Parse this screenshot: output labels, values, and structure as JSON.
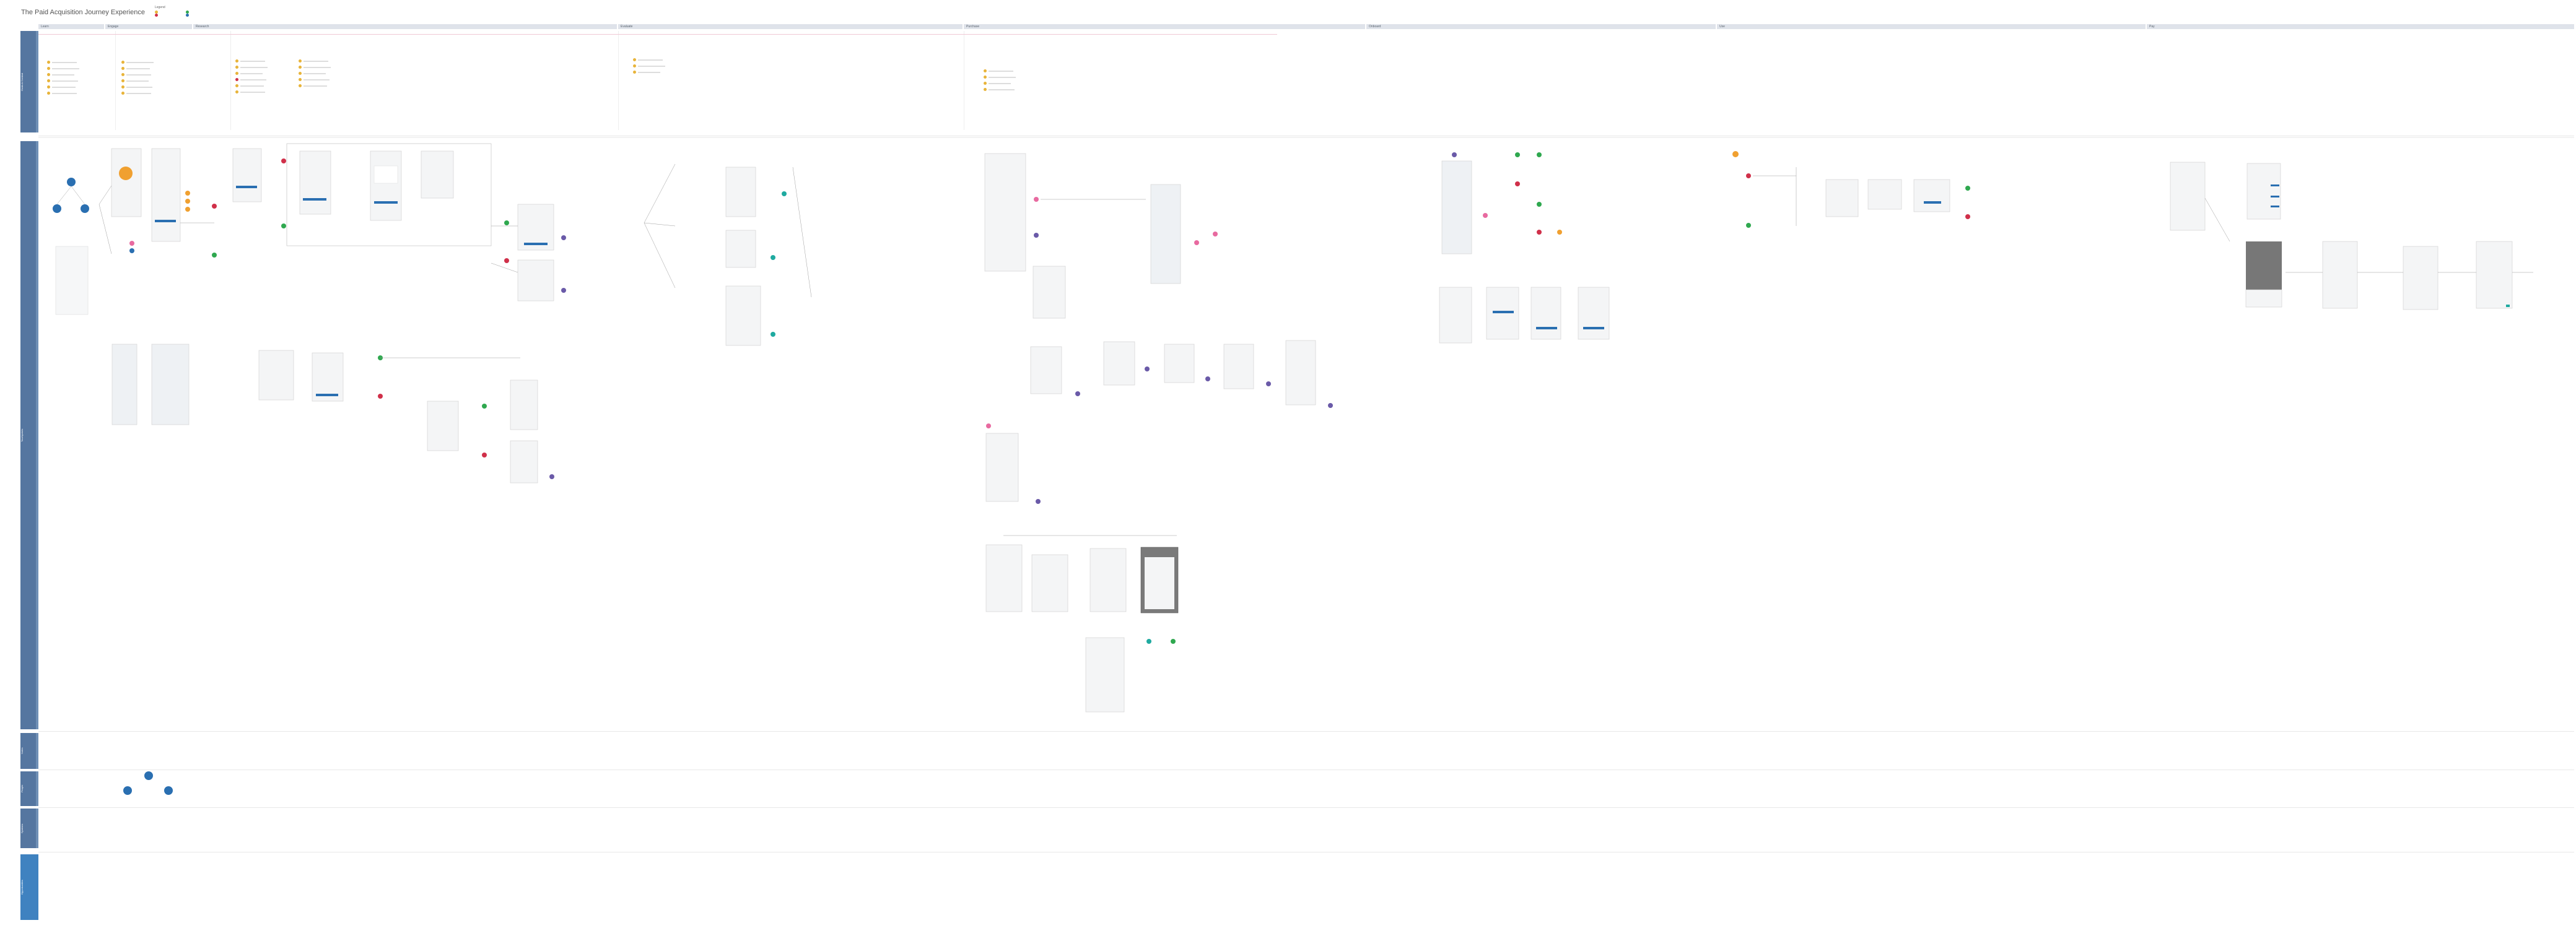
{
  "page_title": "The Paid Acquisition Journey Experience",
  "legend": {
    "heading": "Legend",
    "items": [
      {
        "color": "#e8b43a"
      },
      {
        "color": "#d0304a"
      },
      {
        "color": "#2fa84f"
      },
      {
        "color": "#2a6fb1"
      }
    ]
  },
  "stages": [
    {
      "label": "Learn"
    },
    {
      "label": "Engage"
    },
    {
      "label": "Research"
    },
    {
      "label": "Evaluate"
    },
    {
      "label": "Purchase"
    },
    {
      "label": "Onboard"
    },
    {
      "label": "Use"
    },
    {
      "label": "Pay"
    }
  ],
  "lanes": [
    {
      "label": "Goals & Context"
    },
    {
      "label": "Touchpoints"
    },
    {
      "label": "Notes"
    },
    {
      "label": "People"
    },
    {
      "label": "Systems"
    },
    {
      "label": "Opportunities"
    }
  ],
  "colors": {
    "lane": "#5576a0",
    "stage_bar": "#dfe3ea",
    "yellow": "#e8b43a",
    "red": "#d0304a",
    "green": "#2fa84f",
    "purple": "#6a5aa8",
    "teal": "#1faaa0",
    "pink": "#e86aa0",
    "blue": "#2a6fb1",
    "orange": "#f0a030"
  }
}
